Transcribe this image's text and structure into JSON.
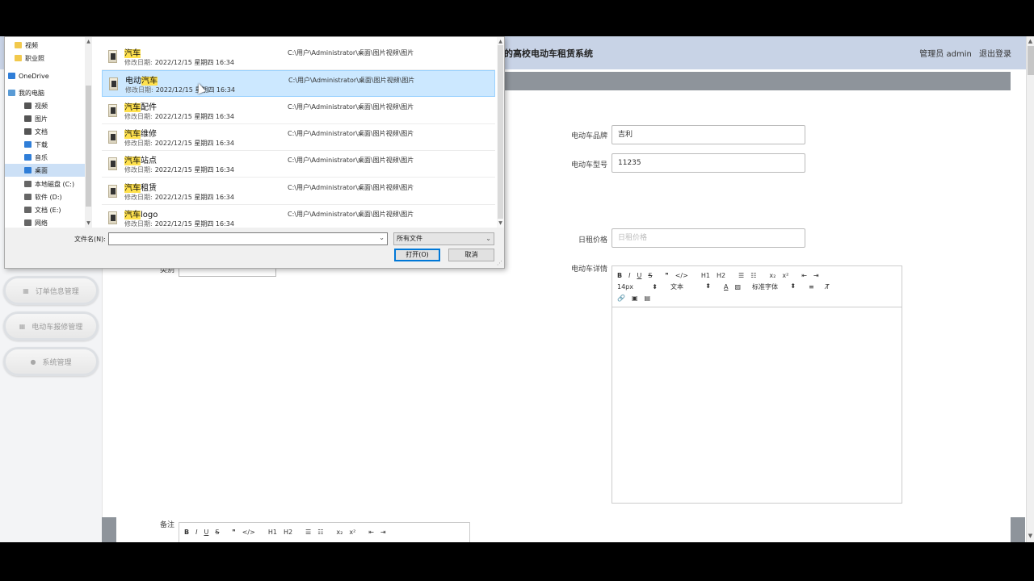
{
  "app": {
    "title": "的高校电动车租赁系统",
    "admin_label": "管理员 admin",
    "logout": "退出登录"
  },
  "sidebar": {
    "items": [
      {
        "label": "订单信息管理",
        "icon": "grid-icon"
      },
      {
        "label": "电动车报修管理",
        "icon": "grid-icon"
      },
      {
        "label": "系统管理",
        "icon": "location-icon"
      }
    ]
  },
  "form": {
    "brand_label": "电动车品牌",
    "brand_value": "吉利",
    "model_label": "电动车型号",
    "model_value": "11235",
    "price_label": "日租价格",
    "price_placeholder": "日租价格",
    "detail_label": "电动车详情",
    "remark_label": "备注",
    "left_partial_label": "类别"
  },
  "editor_toolbar": {
    "row1": [
      "B",
      "I",
      "U",
      "S",
      "❞",
      "</>",
      "H1",
      "H2",
      "☰",
      "☷",
      "x₂",
      "x²",
      "⇤",
      "⇥"
    ],
    "size": "14px",
    "text_type": "文本",
    "font": "标准字体",
    "row3": [
      "link",
      "image",
      "video"
    ]
  },
  "dialog": {
    "nav": [
      {
        "label": "视频",
        "color": "#f2c94c"
      },
      {
        "label": "职业照",
        "color": "#f2c94c"
      },
      {
        "label": "OneDrive",
        "color": "#2f7ed8"
      },
      {
        "label": "我的电脑",
        "color": "#5a9bd5"
      },
      {
        "label": "视频",
        "color": "#555"
      },
      {
        "label": "图片",
        "color": "#555"
      },
      {
        "label": "文档",
        "color": "#555"
      },
      {
        "label": "下载",
        "color": "#2f7ed8"
      },
      {
        "label": "音乐",
        "color": "#2f7ed8"
      },
      {
        "label": "桌面",
        "color": "#2f7ed8"
      },
      {
        "label": "本地磁盘 (C:)",
        "color": "#666"
      },
      {
        "label": "软件 (D:)",
        "color": "#666"
      },
      {
        "label": "文档 (E:)",
        "color": "#666"
      },
      {
        "label": "网络",
        "color": "#666"
      }
    ],
    "date_prefix": "修改日期:",
    "files": [
      {
        "hl": "汽车",
        "rest": "",
        "date": "2022/12/15 星期四 16:34",
        "path": "C:\\用户\\Administrator\\桌面\\图片视频\\图片"
      },
      {
        "pre": "电动",
        "hl": "汽车",
        "rest": "",
        "date": "2022/12/15 星期四 16:34",
        "path": "C:\\用户\\Administrator\\桌面\\图片视频\\图片"
      },
      {
        "hl": "汽车",
        "rest": "配件",
        "date": "2022/12/15 星期四 16:34",
        "path": "C:\\用户\\Administrator\\桌面\\图片视频\\图片"
      },
      {
        "hl": "汽车",
        "rest": "维修",
        "date": "2022/12/15 星期四 16:34",
        "path": "C:\\用户\\Administrator\\桌面\\图片视频\\图片"
      },
      {
        "hl": "汽车",
        "rest": "站点",
        "date": "2022/12/15 星期四 16:34",
        "path": "C:\\用户\\Administrator\\桌面\\图片视频\\图片"
      },
      {
        "hl": "汽车",
        "rest": "租赁",
        "date": "2022/12/15 星期四 16:34",
        "path": "C:\\用户\\Administrator\\桌面\\图片视频\\图片"
      },
      {
        "hl": "汽车",
        "rest": "logo",
        "date": "2022/12/15 星期四 16:34",
        "path": "C:\\用户\\Administrator\\桌面\\图片视频\\图片"
      }
    ],
    "selected_index": 1,
    "filename_label": "文件名(N):",
    "filename_value": "",
    "filetype": "所有文件",
    "open_button": "打开(O)",
    "cancel_button": "取消"
  }
}
